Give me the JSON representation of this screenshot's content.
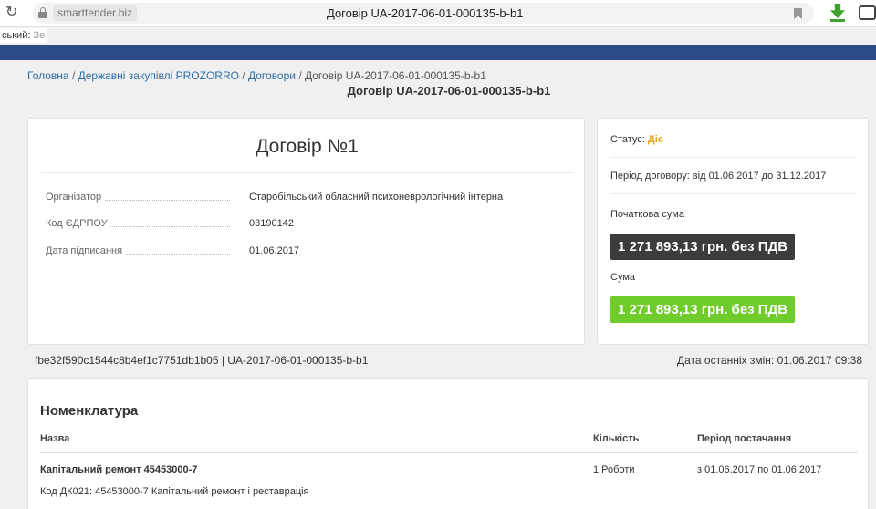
{
  "browser": {
    "domain": "smarttender.biz",
    "tab_title": "Договір UA-2017-06-01-000135-b-b1",
    "reload_icon": "reload-icon",
    "translit_prefix": "ський:",
    "translit_hint": " Зе"
  },
  "breadcrumb": {
    "home": "Головна",
    "prozorro": "Державні закупівлі PROZORRO",
    "contracts": "Договори",
    "current": "Договір UA-2017-06-01-000135-b-b1"
  },
  "page_title": "Договір UA-2017-06-01-000135-b-b1",
  "contract": {
    "title": "Договір №1",
    "rows": [
      {
        "label": "Організатор",
        "value": "Старобільський обласний психоневрологічний інтерна"
      },
      {
        "label": "Код ЄДРПОУ",
        "value": "03190142"
      },
      {
        "label": "Дата підписання",
        "value": "01.06.2017"
      }
    ]
  },
  "status": {
    "status_label": "Статус:",
    "status_value": "Діє",
    "period": "Період договору: від 01.06.2017 до 31.12.2017",
    "initial_label": "Початкова сума",
    "initial_amount": "1 271 893,13 грн. без ПДВ",
    "sum_label": "Сума",
    "sum_amount": "1 271 893,13 грн. без ПДВ",
    "colors": {
      "active": "#e5a623",
      "dark_badge": "#3c3c3c",
      "green_badge": "#6fcc2b"
    }
  },
  "meta": {
    "hash_line": "fbe32f590c1544c8b4ef1c7751db1b05 | UA-2017-06-01-000135-b-b1",
    "last_change": "Дата останніх змін: 01.06.2017 09:38"
  },
  "nomenclature": {
    "title": "Номенклатура",
    "headers": {
      "name": "Назва",
      "qty": "Кількість",
      "period": "Період постачання"
    },
    "items": [
      {
        "name": "Капітальний ремонт 45453000-7",
        "qty": "1 Роботи",
        "period": "з 01.06.2017 по 01.06.2017",
        "code": "Код ДК021: 45453000-7 Капітальний ремонт і реставрація"
      }
    ]
  }
}
